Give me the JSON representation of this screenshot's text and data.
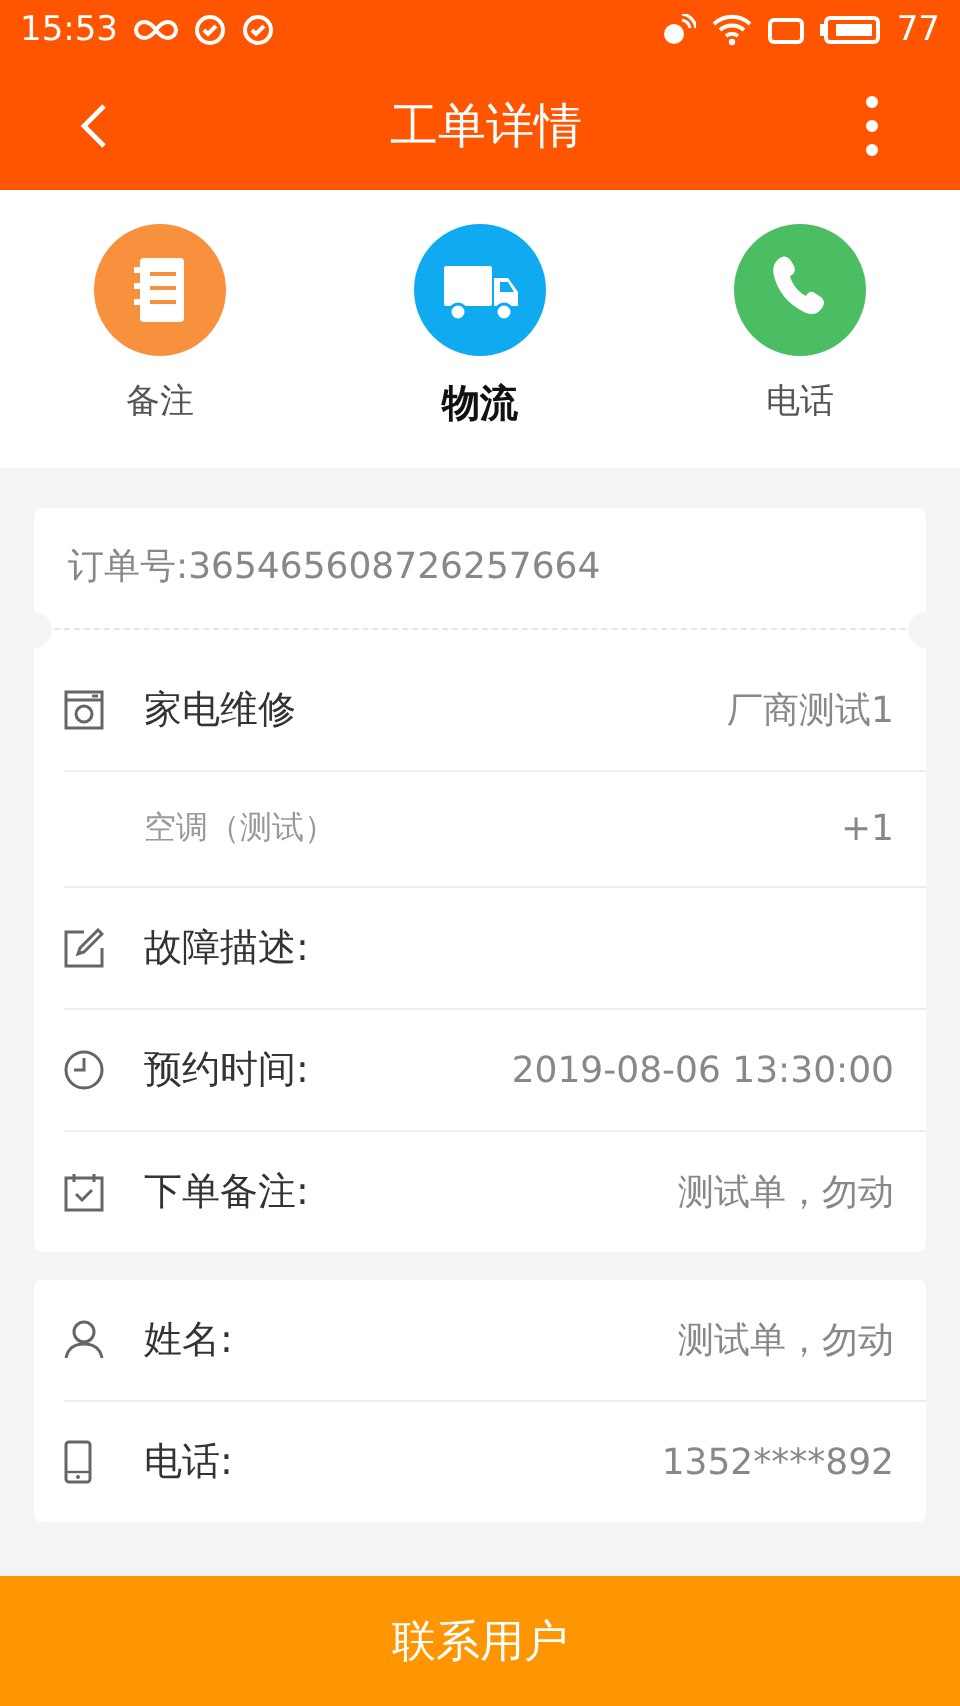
{
  "status_bar": {
    "time": "15:53",
    "battery": "77"
  },
  "header": {
    "title": "工单详情"
  },
  "tabs": [
    {
      "label": "备注",
      "selected": false
    },
    {
      "label": "物流",
      "selected": true
    },
    {
      "label": "电话",
      "selected": false
    }
  ],
  "order_card": {
    "order_number": "订单号:365465608726257664",
    "rows": [
      {
        "kind": "item",
        "label": "家电维修",
        "value": "厂商测试1"
      },
      {
        "kind": "sub",
        "label": "空调（测试）",
        "value": "+1"
      },
      {
        "kind": "item",
        "label": "故障描述:"
      },
      {
        "kind": "item",
        "label": "预约时间:",
        "value": "2019-08-06 13:30:00"
      },
      {
        "kind": "item",
        "label": "下单备注:",
        "value": "测试单，勿动"
      }
    ]
  },
  "customer_card": {
    "rows": [
      {
        "label": "姓名:",
        "value": "测试单，勿动"
      },
      {
        "label": "电话:",
        "value": "1352****892"
      }
    ]
  },
  "contact_button": "联系用户"
}
